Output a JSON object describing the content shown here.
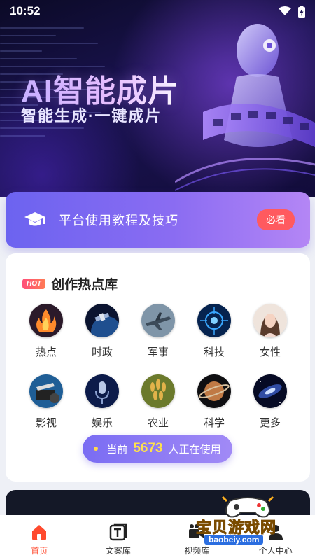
{
  "status_bar": {
    "time": "10:52",
    "icons": [
      "wifi-icon",
      "battery-charging-icon"
    ]
  },
  "banner": {
    "title": "AI智能成片",
    "subtitle": "智能生成·一键成片"
  },
  "tutorial": {
    "label": "平台使用教程及技巧",
    "badge": "必看",
    "icon": "graduation-cap-icon"
  },
  "hot_library": {
    "badge": "HOT",
    "title": "创作热点库",
    "items": [
      {
        "label": "热点",
        "icon": "fire-icon"
      },
      {
        "label": "时政",
        "icon": "satellite-icon"
      },
      {
        "label": "军事",
        "icon": "fighter-jet-icon"
      },
      {
        "label": "科技",
        "icon": "tech-icon"
      },
      {
        "label": "女性",
        "icon": "woman-icon"
      },
      {
        "label": "影视",
        "icon": "film-icon"
      },
      {
        "label": "娱乐",
        "icon": "microphone-icon"
      },
      {
        "label": "农业",
        "icon": "wheat-icon"
      },
      {
        "label": "科学",
        "icon": "planet-icon"
      },
      {
        "label": "更多",
        "icon": "galaxy-icon"
      }
    ],
    "usage": {
      "prefix": "当前",
      "count": "5673",
      "suffix": "人正在使用"
    }
  },
  "bottom_nav": {
    "items": [
      {
        "label": "首页",
        "icon": "home-icon",
        "active": true
      },
      {
        "label": "文案库",
        "icon": "text-document-icon",
        "active": false
      },
      {
        "label": "视频库",
        "icon": "video-camera-icon",
        "active": false
      },
      {
        "label": "个人中心",
        "icon": "user-icon",
        "active": false
      }
    ]
  },
  "watermark": {
    "text": "宝贝游戏网",
    "url": "baobeiy.com"
  },
  "colors": {
    "accent": "#7a6cf3",
    "badge_red": "#ff5a5f",
    "active_nav": "#ff4a2e",
    "usage_count": "#ffe24a"
  }
}
